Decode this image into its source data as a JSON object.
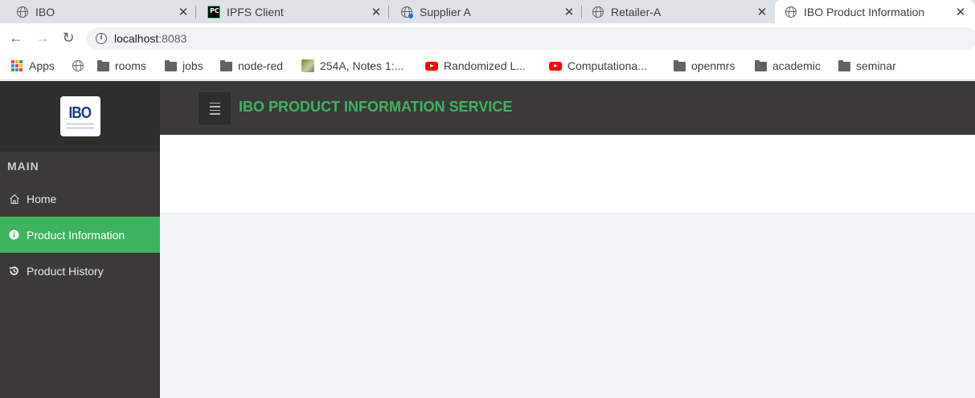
{
  "browser": {
    "tabs": [
      {
        "title": "IBO",
        "icon": "globe-icon",
        "close": "✕"
      },
      {
        "title": "IPFS Client",
        "icon": "pycharm-icon",
        "close": "✕"
      },
      {
        "title": "Supplier A",
        "icon": "globe-icon",
        "close": "✕"
      },
      {
        "title": "Retailer-A",
        "icon": "globe-icon",
        "close": "✕"
      },
      {
        "title": "IBO Product Information",
        "icon": "globe-icon",
        "close": "✕",
        "active": true
      }
    ],
    "address": {
      "host": "localhost",
      "port": ":8083"
    },
    "bookmarks": [
      {
        "label": "Apps",
        "icon": "apps-grid-icon"
      },
      {
        "label": "",
        "icon": "globe-icon"
      },
      {
        "label": "rooms",
        "icon": "folder-icon"
      },
      {
        "label": "jobs",
        "icon": "folder-icon"
      },
      {
        "label": "node-red",
        "icon": "folder-icon"
      },
      {
        "label": "254A, Notes 1:...",
        "icon": "thumbnail-icon"
      },
      {
        "label": "Randomized L...",
        "icon": "youtube-icon"
      },
      {
        "label": "Computationa...",
        "icon": "youtube-icon"
      },
      {
        "label": "openmrs",
        "icon": "folder-icon"
      },
      {
        "label": "academic",
        "icon": "folder-icon"
      },
      {
        "label": "seminar",
        "icon": "folder-icon"
      }
    ]
  },
  "app": {
    "logo_text": "IBO",
    "title": "IBO PRODUCT INFORMATION SERVICE",
    "sidebar": {
      "heading": "MAIN",
      "items": [
        {
          "label": "Home",
          "icon": "home-icon"
        },
        {
          "label": "Product Information",
          "icon": "info-circle-icon",
          "active": true
        },
        {
          "label": "Product History",
          "icon": "history-icon"
        }
      ]
    }
  },
  "colors": {
    "accent": "#3eb35f",
    "sidebar": "#3b3a38",
    "brand_bar": "#2e2e2d",
    "content_bg": "#f2f5f8"
  }
}
